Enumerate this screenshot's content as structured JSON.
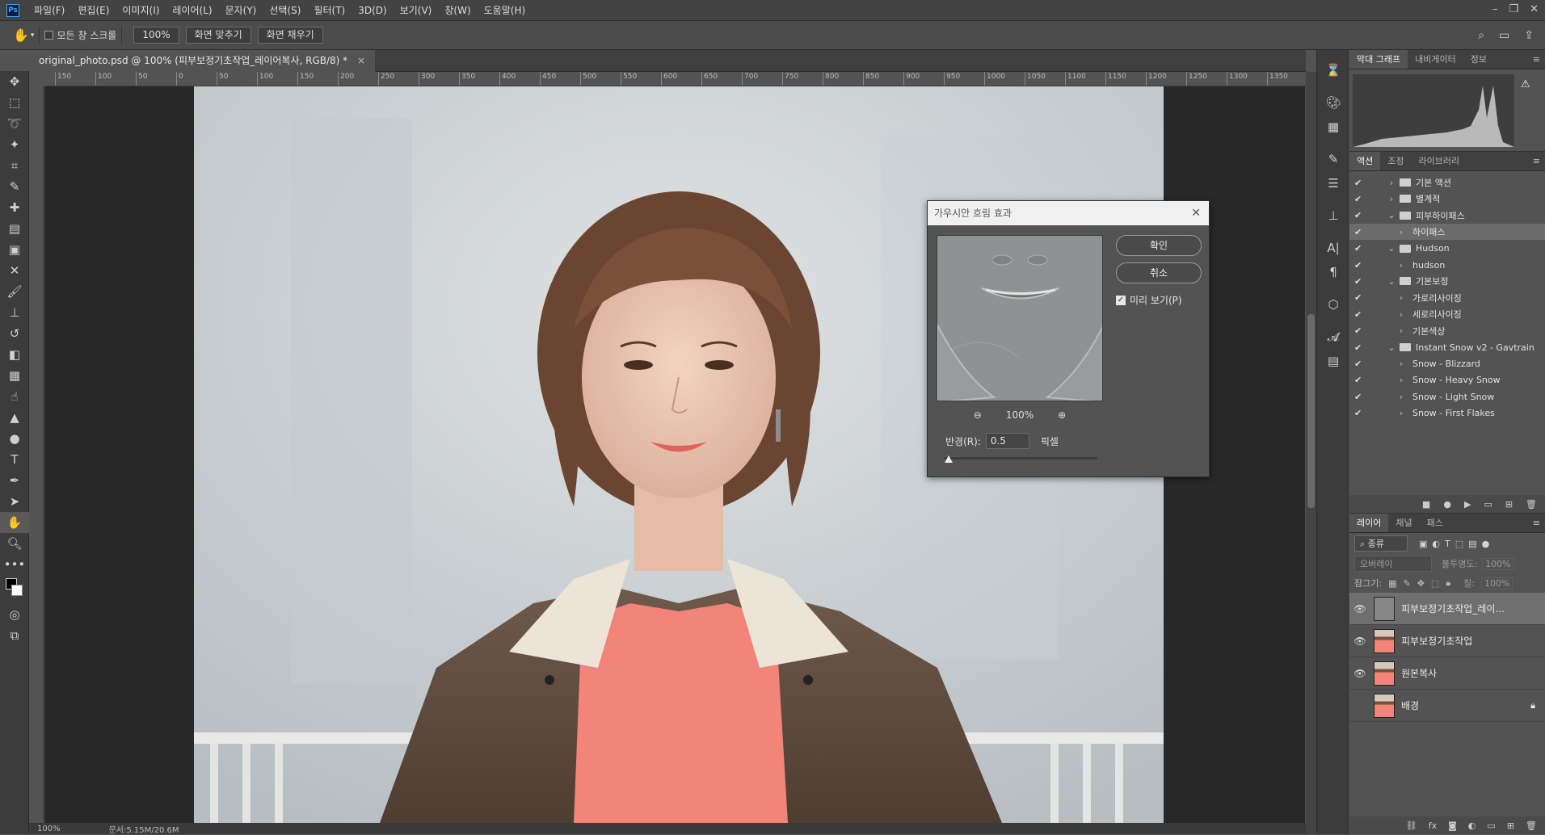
{
  "app": {
    "logo": "Ps"
  },
  "menu": [
    "파일(F)",
    "편집(E)",
    "이미지(I)",
    "레이어(L)",
    "문자(Y)",
    "선택(S)",
    "필터(T)",
    "3D(D)",
    "보기(V)",
    "창(W)",
    "도움말(H)"
  ],
  "options": {
    "scroll_all_label": "모든 창 스크롤",
    "zoom_value": "100%",
    "fit_screen": "화면 맞추기",
    "fill_screen": "화면 채우기"
  },
  "document": {
    "tab_title": "original_photo.psd @ 100% (피부보정기초작업_레이어복사, RGB/8) *",
    "close": "×"
  },
  "ruler_ticks": [
    "150",
    "100",
    "50",
    "0",
    "50",
    "100",
    "150",
    "200",
    "250",
    "300",
    "350",
    "400",
    "450",
    "500",
    "550",
    "600",
    "650",
    "700",
    "750",
    "800",
    "850",
    "900",
    "950",
    "1000",
    "1050",
    "1100",
    "1150",
    "1200",
    "1250",
    "1300",
    "1350"
  ],
  "status": {
    "zoom": "100%",
    "doc": "문서:5.15M/20.6M"
  },
  "dialog": {
    "title": "가우시안 흐림 효과",
    "ok": "확인",
    "cancel": "취소",
    "preview_label": "미리 보기(P)",
    "zoom": "100%",
    "radius_label": "반경(R):",
    "radius_value": "0.5",
    "radius_unit": "픽셀",
    "radius_slider": 0.03
  },
  "panels": {
    "top_tabs": [
      "막대 그래프",
      "내비게이터",
      "정보"
    ],
    "mid_tabs": [
      "액션",
      "조정",
      "라이브러리"
    ],
    "layer_tabs": [
      "레이어",
      "채널",
      "패스"
    ],
    "layer_filter": "종류",
    "blend_mode": "오버레이",
    "opacity_label": "불투명도:",
    "opacity_value": "100%",
    "lock_label": "잠그기:",
    "fill_label": "칠:",
    "fill_value": "100%"
  },
  "actions": [
    {
      "label": "기본 액션",
      "type": "folder",
      "level": 0
    },
    {
      "label": "별계적",
      "type": "folder",
      "level": 0
    },
    {
      "label": "피부하이패스",
      "type": "folder",
      "level": 0,
      "open": true
    },
    {
      "label": "하이패스",
      "type": "action",
      "level": 1,
      "selected": true
    },
    {
      "label": "Hudson",
      "type": "folder",
      "level": 0,
      "open": true
    },
    {
      "label": "hudson",
      "type": "action",
      "level": 1
    },
    {
      "label": "기본보정",
      "type": "folder",
      "level": 0,
      "open": true
    },
    {
      "label": "가로리사이징",
      "type": "action",
      "level": 1
    },
    {
      "label": "세로리사이징",
      "type": "action",
      "level": 1
    },
    {
      "label": "기본색상",
      "type": "action",
      "level": 1
    },
    {
      "label": "Instant Snow v2 - Gavtrain",
      "type": "folder",
      "level": 0,
      "open": true
    },
    {
      "label": "Snow - Blizzard",
      "type": "action",
      "level": 1
    },
    {
      "label": "Snow - Heavy Snow",
      "type": "action",
      "level": 1
    },
    {
      "label": "Snow - Light Snow",
      "type": "action",
      "level": 1
    },
    {
      "label": "Snow - First Flakes",
      "type": "action",
      "level": 1
    }
  ],
  "layers": [
    {
      "name": "피부보정기초작업_레이...",
      "visible": true,
      "selected": true,
      "thumb": "gray"
    },
    {
      "name": "피부보정기초작업",
      "visible": true,
      "thumb": "photo"
    },
    {
      "name": "원본복사",
      "visible": true,
      "thumb": "photo"
    },
    {
      "name": "배경",
      "visible": false,
      "thumb": "photo",
      "locked": true
    }
  ]
}
